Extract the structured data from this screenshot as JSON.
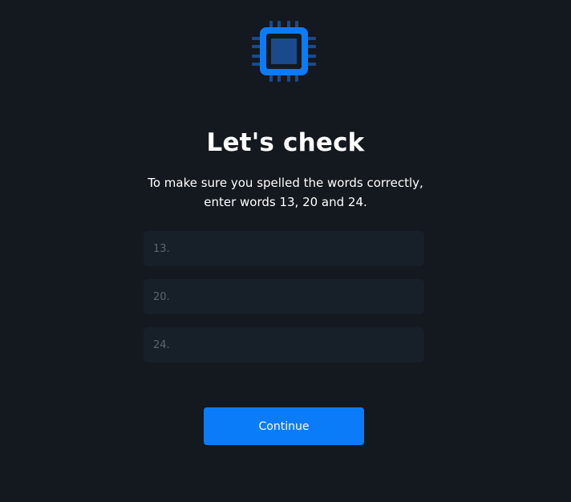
{
  "header": {
    "icon": "chip-icon",
    "title": "Let's check",
    "subtitle_line1": "To make sure you spelled the words correctly,",
    "subtitle_line2": "enter words 13, 20 and 24."
  },
  "form": {
    "fields": [
      {
        "placeholder": "13.",
        "value": ""
      },
      {
        "placeholder": "20.",
        "value": ""
      },
      {
        "placeholder": "24.",
        "value": ""
      }
    ],
    "continue_label": "Continue"
  },
  "colors": {
    "background": "#141920",
    "accent": "#0a7cfa",
    "input_background": "#171f29",
    "placeholder": "#5a6573"
  }
}
